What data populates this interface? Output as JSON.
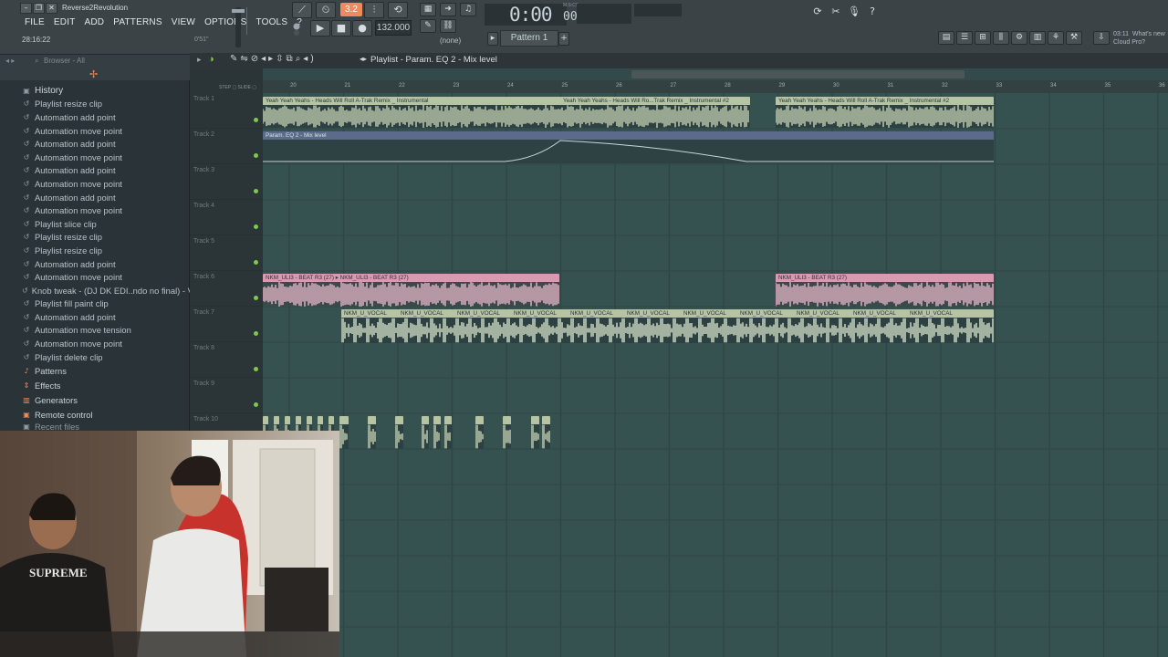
{
  "app": {
    "title": "Reverse2Revolution",
    "menu": [
      "FILE",
      "EDIT",
      "ADD",
      "PATTERNS",
      "VIEW",
      "OPTIONS",
      "TOOLS",
      "?"
    ],
    "time_readout": "28:16:22",
    "time_readout2": "0'51\"",
    "rec_badge": "3.2",
    "tempo": "132.000",
    "time_display": "0:00",
    "time_ms": "00",
    "time_mscs": "M:S:CS",
    "pattern": "Pattern 1",
    "none_label": "(none)",
    "hint": "03:11  What's new\nCloud Pro?"
  },
  "browser": {
    "title": "Browser - All",
    "history_label": "History",
    "history": [
      "Playlist resize clip",
      "Automation add point",
      "Automation move point",
      "Automation add point",
      "Automation move point",
      "Automation add point",
      "Automation move point",
      "Automation add point",
      "Automation move point",
      "Playlist slice clip",
      "Playlist resize clip",
      "Playlist resize clip",
      "Automation add point",
      "Automation move point",
      "Knob tweak - (DJ DK EDI..ndo no final) - Volume",
      "Playlist fill paint clip",
      "Automation add point",
      "Automation move tension",
      "Automation move point",
      "Playlist delete clip"
    ],
    "categories": [
      "Patterns",
      "Effects",
      "Generators",
      "Remote control"
    ],
    "recent": "Recent files"
  },
  "playlist": {
    "title": "Playlist - Param. EQ 2 - Mix level",
    "bars": [
      "20",
      "21",
      "22",
      "23",
      "24",
      "25",
      "26",
      "27",
      "28",
      "29",
      "30",
      "31",
      "32",
      "33",
      "34",
      "35",
      "36"
    ],
    "tracks": [
      "Track 1",
      "Track 2",
      "Track 3",
      "Track 4",
      "Track 5",
      "Track 6",
      "Track 7",
      "Track 8",
      "Track 9",
      "Track 10"
    ],
    "clips": {
      "t1a": "Yeah Yeah Yeahs - Heads Will Roll A-Trak Remix _ Instrumental",
      "t1b": "Yeah Yeah Yeahs - Heads Will Ro...Trak Remix _ Instrumental #2",
      "t1c": "Yeah Yeah Yeahs - Heads Will Roll A-Trak Remix _ Instrumental #2",
      "t2": "Param. EQ 2 - Mix level",
      "t6a": "NKM_ULI3 - BEAT R3 (27)  ▸ NKM_ULI3 - BEAT R3 (27)",
      "t6b": "NKM_ULI3 - BEAT R3 (27)",
      "t7": "NKM_U_VOCAL"
    }
  },
  "colors": {
    "accent": "#f08a5d",
    "audio_clip": "#c7d3b4",
    "beat_clip": "#e8b9c9",
    "grid": "#355150",
    "led": "#7fc84b"
  }
}
